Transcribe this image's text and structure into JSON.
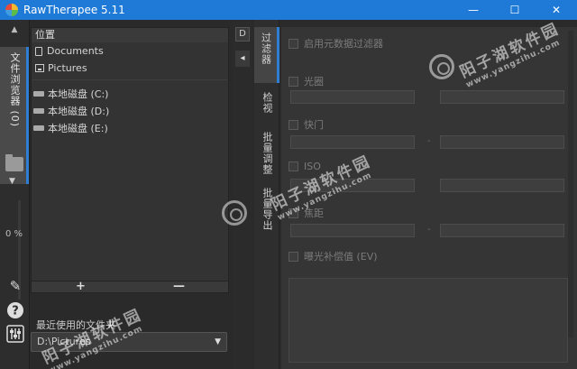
{
  "window": {
    "title": "RawTherapee 5.11",
    "minimize": "—",
    "maximize": "☐",
    "close": "✕"
  },
  "left_strip": {
    "collapse": "▲",
    "file_browser_tab": "文件浏览器 (0)",
    "down": "▼",
    "progress": "0 %"
  },
  "browser": {
    "header": "位置",
    "places": [
      {
        "label": "Documents",
        "icon": "document-icon"
      },
      {
        "label": "Pictures",
        "icon": "pictures-icon"
      }
    ],
    "drives": [
      {
        "label": "本地磁盘 (C:)"
      },
      {
        "label": "本地磁盘 (D:)"
      },
      {
        "label": "本地磁盘 (E:)"
      }
    ],
    "add": "+",
    "remove": "—",
    "recent_label": "最近使用的文件夹",
    "recent_value": "D:\\Pictures"
  },
  "middle": {
    "d_label": "D",
    "back": "◂"
  },
  "right_tabs": [
    {
      "label": "过滤器",
      "active": true
    },
    {
      "label": "检视",
      "active": false
    },
    {
      "label": "批量调整",
      "active": false
    },
    {
      "label": "批量导出",
      "active": false
    }
  ],
  "filter": {
    "enable": "启用元数据过滤器",
    "aperture": "光圈",
    "shutter": "快门",
    "iso": "ISO",
    "focal": "焦距",
    "exposure": "曝光补偿值 (EV)",
    "dash": "-"
  },
  "watermark": {
    "site_cn": "阳子湖软件园",
    "url": "www.yangzihu.com"
  }
}
